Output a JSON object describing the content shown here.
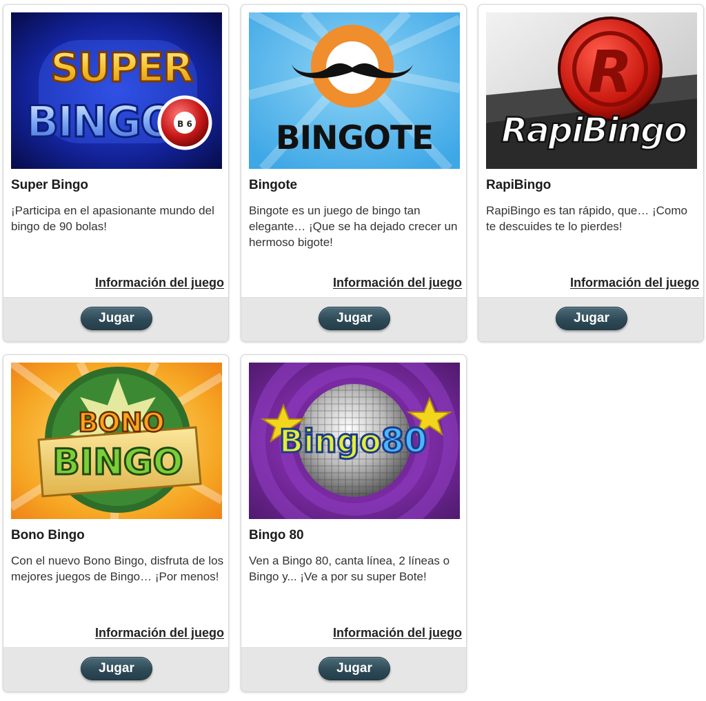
{
  "games": [
    {
      "title": "Super Bingo",
      "description": "¡Participa en el apasionante mundo del bingo de 90 bolas!",
      "info_link": "Información del juego",
      "play_label": "Jugar",
      "logo_text": [
        "SUPER",
        "BINGO"
      ],
      "logo_ball": "B 6"
    },
    {
      "title": "Bingote",
      "description": "Bingote es un juego de bingo tan elegante… ¡Que se ha dejado crecer un hermoso bigote!",
      "info_link": "Información del juego",
      "play_label": "Jugar",
      "logo_text": [
        "BINGOTE"
      ]
    },
    {
      "title": "RapiBingo",
      "description": "RapiBingo es tan rápido, que… ¡Como te descuides te lo pierdes!",
      "info_link": "Información del juego",
      "play_label": "Jugar",
      "logo_text": [
        "RapiBingo",
        "R"
      ]
    },
    {
      "title": "Bono Bingo",
      "description": "Con el nuevo Bono Bingo, disfruta de los mejores juegos de Bingo… ¡Por menos!",
      "info_link": "Información del juego",
      "play_label": "Jugar",
      "logo_text": [
        "BONO",
        "BINGO"
      ]
    },
    {
      "title": "Bingo 80",
      "description": "Ven a Bingo 80, canta línea, 2 líneas o Bingo y... ¡Ve a por su super Bote!",
      "info_link": "Información del juego",
      "play_label": "Jugar",
      "logo_text": [
        "Bingo",
        "80"
      ]
    }
  ],
  "colors": {
    "play_button": "#2f4b58",
    "footer_bar": "#e6e6e6",
    "card_border": "#d6d6d6"
  }
}
